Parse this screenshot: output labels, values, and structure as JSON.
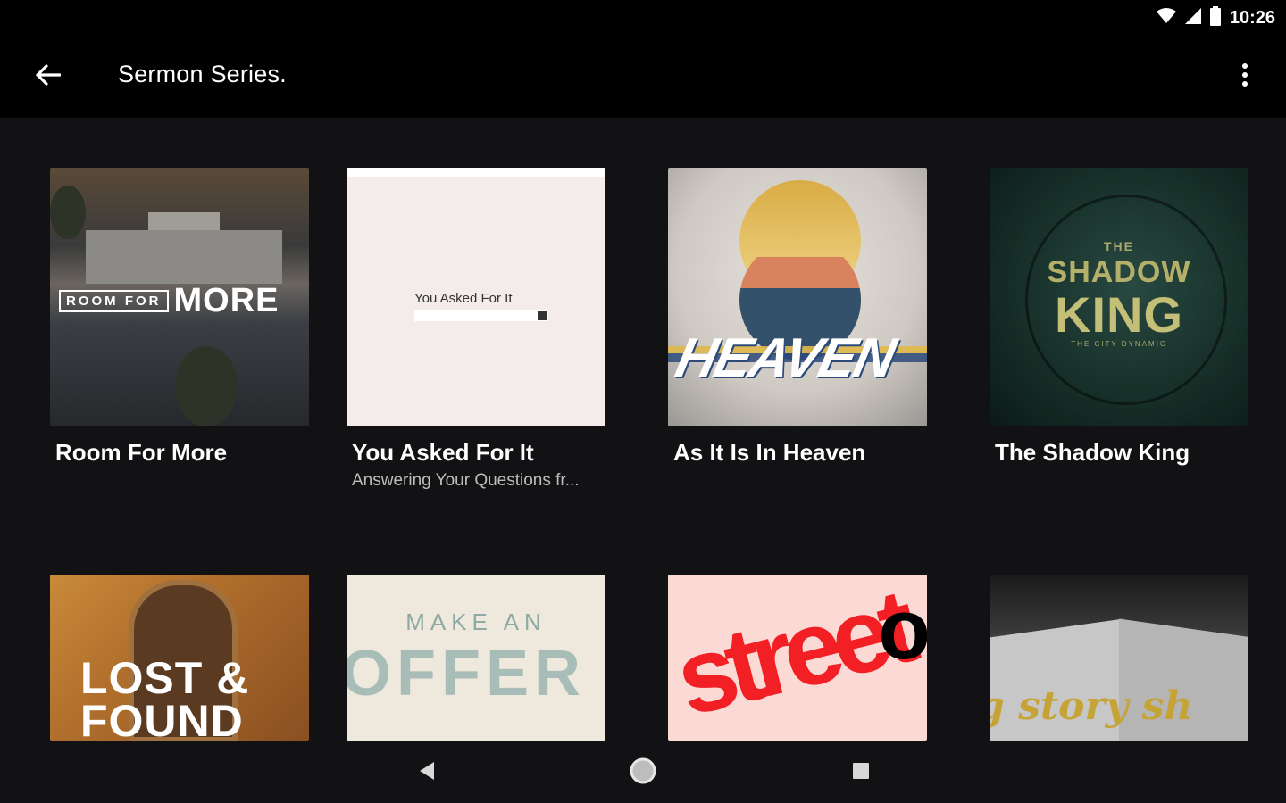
{
  "status_bar": {
    "time": "10:26"
  },
  "app_bar": {
    "title": "Sermon Series."
  },
  "series": [
    {
      "title": "Room For More",
      "subtitle": "",
      "art_small": "ROOM FOR",
      "art_big": "MORE"
    },
    {
      "title": "You Asked For It",
      "subtitle": "Answering Your Questions fr...",
      "art_text": "You Asked For It"
    },
    {
      "title": "As It Is In Heaven",
      "subtitle": "",
      "art_text": "HEAVEN"
    },
    {
      "title": "The Shadow King",
      "subtitle": "",
      "art_the": "THE",
      "art_shadow": "SHADOW",
      "art_king": "KING",
      "art_sub": "THE CITY DYNAMIC"
    },
    {
      "title": "",
      "art_text": "LOST & FOUND"
    },
    {
      "title": "",
      "art_small": "MAKE AN",
      "art_big": "OFFER"
    },
    {
      "title": "",
      "art_text": "street",
      "art_o": "o"
    },
    {
      "title": "",
      "art_text": "g story sh"
    }
  ],
  "icons": {
    "back": "arrow-left-icon",
    "more": "more-vert-icon",
    "wifi": "wifi-icon",
    "signal": "signal-icon",
    "battery": "battery-icon",
    "nav_back": "triangle-back-icon",
    "nav_home": "circle-home-icon",
    "nav_recents": "square-recents-icon"
  }
}
